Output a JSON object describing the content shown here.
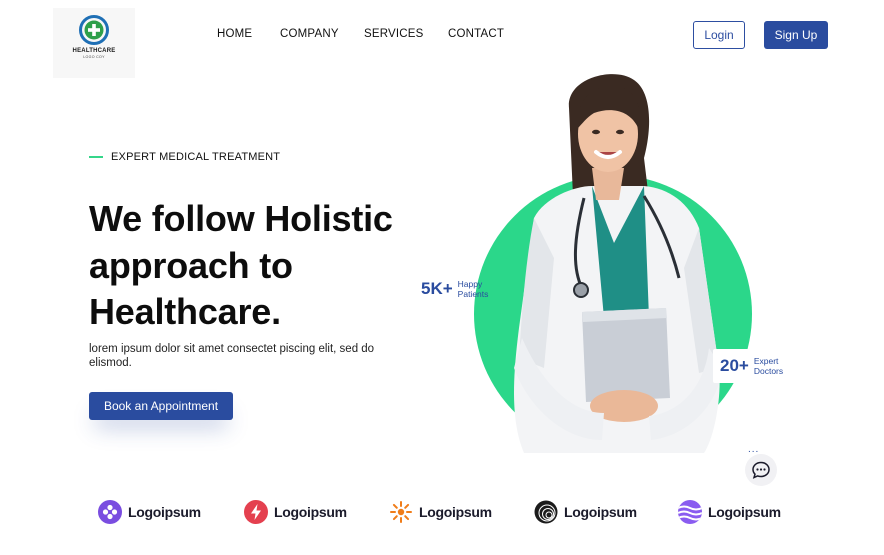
{
  "brand": {
    "title": "HEALTHCARE",
    "subtitle": "LOGO COY"
  },
  "nav": {
    "items": [
      "HOME",
      "COMPANY",
      "SERVICES",
      "CONTACT"
    ]
  },
  "header": {
    "login_label": "Login",
    "signup_label": "Sign Up"
  },
  "hero": {
    "eyebrow": "EXPERT MEDICAL TREATMENT",
    "headline_lines": [
      "We follow Holistic",
      "approach to",
      "Healthcare."
    ],
    "subtext": "lorem ipsum dolor sit amet consectet piscing elit, sed do elismod.",
    "cta_label": "Book an Appointment"
  },
  "stats": [
    {
      "value": "5K+",
      "label_line1": "Happy",
      "label_line2": "Patients"
    },
    {
      "value": "20+",
      "label_line1": "Expert",
      "label_line2": "Doctors"
    }
  ],
  "chat": {
    "dots": "..."
  },
  "partners": [
    "Logoipsum",
    "Logoipsum",
    "Logoipsum",
    "Logoipsum",
    "Logoipsum"
  ],
  "colors": {
    "primary": "#2a4c9f",
    "accent_green": "#2bd78a",
    "text": "#111111"
  }
}
